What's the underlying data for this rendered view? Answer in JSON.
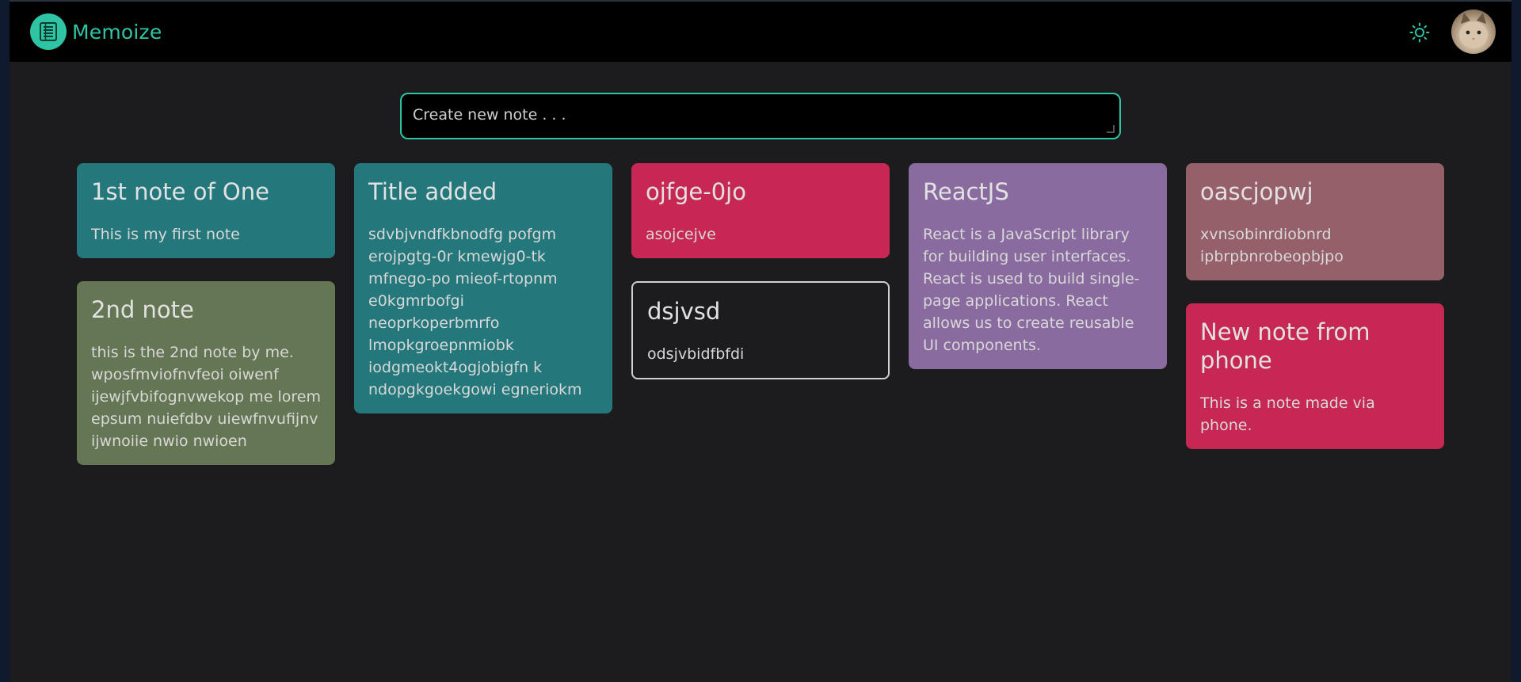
{
  "app": {
    "name": "Memoize",
    "accent": "#2ec4a4",
    "logo_icon": "notes-list-icon",
    "theme_icon": "sun-icon",
    "avatar": "user-avatar-cat"
  },
  "create_note": {
    "placeholder": "Create new note . . ."
  },
  "columns": [
    {
      "notes": [
        {
          "title": "1st note of One",
          "body": "This is my first note",
          "color": "#24787b"
        },
        {
          "title": "2nd note",
          "body": "this is the 2nd note by me. wposfmviofnvfeoi oiwenf ijewjfvbifognvwekop me lorem epsum nuiefdbv uiewfnvufijnv ijwnoiie nwio nwioen",
          "color": "#647653"
        }
      ]
    },
    {
      "notes": [
        {
          "title": "Title added",
          "body": "sdvbjvndfkbnodfg pofgm erojpgtg-0r kmewjg0-tk mfnego-po mieof-rtopnm e0kgmrbofgi neoprkoperbmrfo lmopkgroepnmiobk iodgmeokt4ogjobigfn k ndopgkgoekgowi egneriokm",
          "color": "#24787b"
        }
      ]
    },
    {
      "notes": [
        {
          "title": "ojfge-0jo",
          "body": "asojcejve",
          "color": "#c72753"
        },
        {
          "title": "dsjvsd",
          "body": "odsjvbidfbfdi",
          "color": "outline"
        }
      ]
    },
    {
      "notes": [
        {
          "title": "ReactJS",
          "body": "React is a JavaScript library for building user interfaces. React is used to build single-page applications. React allows us to create reusable UI components.",
          "color": "#8a6b9f"
        }
      ]
    },
    {
      "notes": [
        {
          "title": "oascjopwj",
          "body": "xvnsobinrdiobnrd ipbrpbnrobeopbjpo",
          "color": "#956069"
        },
        {
          "title": "New note from phone",
          "body": "This is a note made via phone.",
          "color": "#c72753"
        }
      ]
    }
  ]
}
